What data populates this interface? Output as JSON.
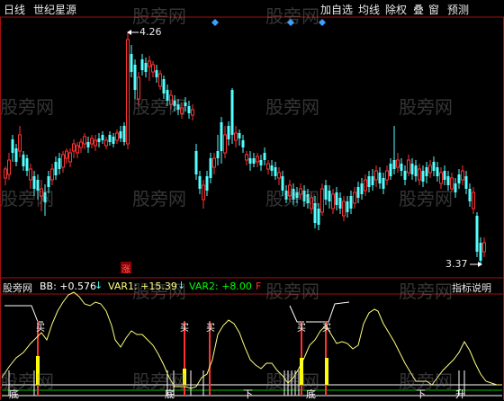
{
  "toolbar": {
    "left": [
      "日线",
      "世纪星源"
    ],
    "right": [
      "加自选",
      "均线",
      "除权",
      "叠",
      "窗",
      "预测"
    ]
  },
  "watermark": "股旁网",
  "price_chart": {
    "high_label": "4.26",
    "low_label": "3.37",
    "zhang_label": "涨",
    "colors": {
      "up": "#ff3232",
      "down": "#54ffff",
      "diamond": "#3ca0ff"
    }
  },
  "indicator": {
    "name": "股旁网",
    "bb": "BB: +0.576",
    "var1": "VAR1: +15.39",
    "var2": "VAR2: +8.00",
    "extra": "F",
    "help": "指标说明",
    "signals": {
      "buy": "买",
      "bottom": "底",
      "down": "下",
      "rise": "升"
    },
    "colors": {
      "curve": "#ffff80",
      "bb": "#ffffff",
      "var1": "#ffff80",
      "var2": "#00ff00"
    }
  }
}
